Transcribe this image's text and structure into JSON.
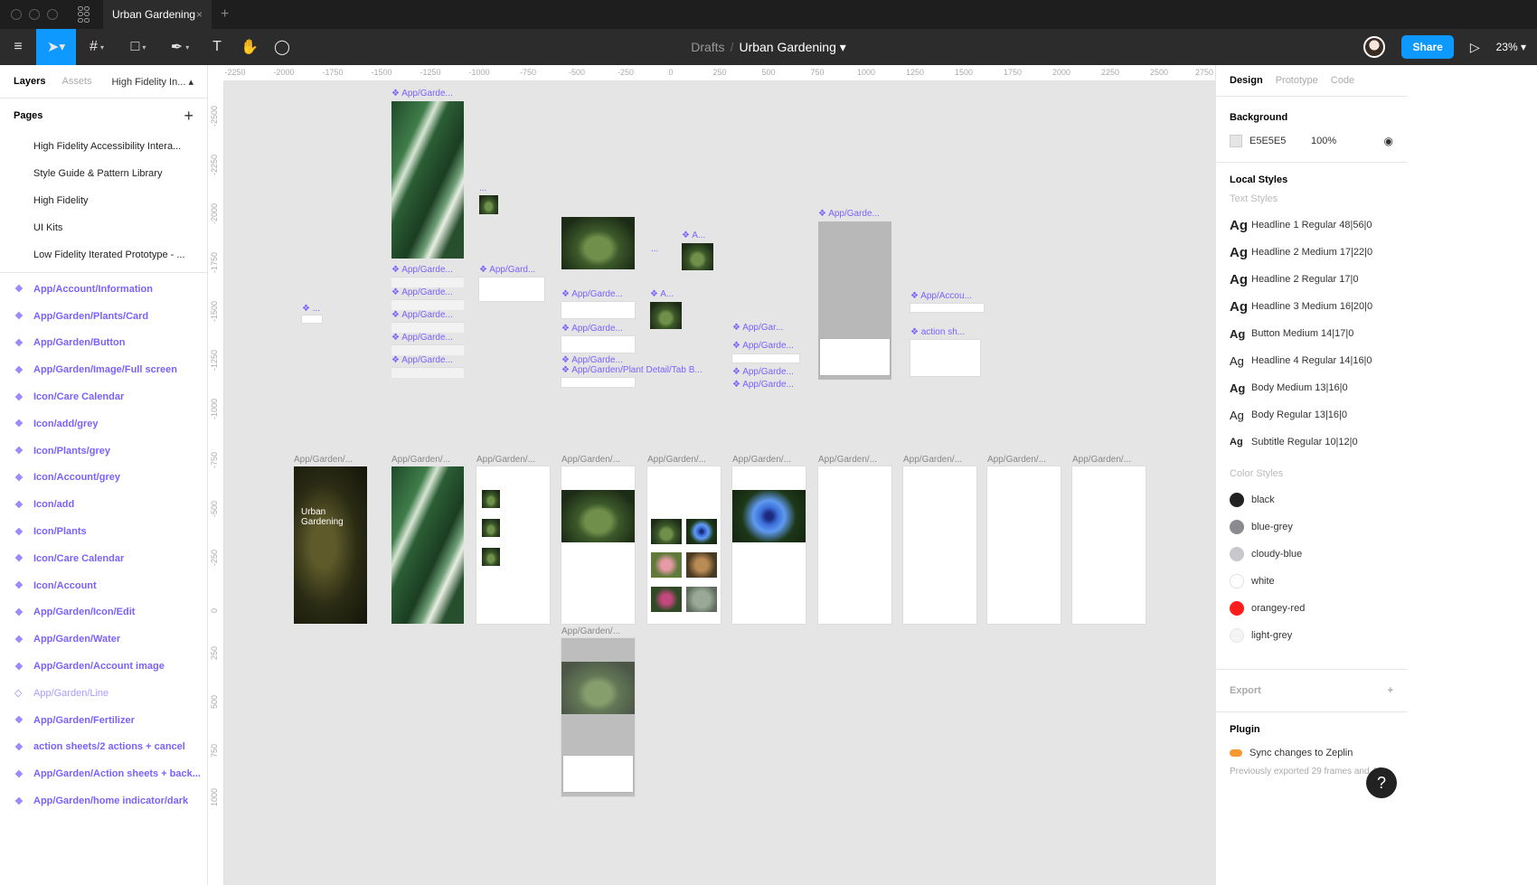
{
  "titlebar": {
    "tab_title": "Urban Gardening",
    "close": "×",
    "new_tab": "+"
  },
  "toolbar": {
    "menu_icon": "≡",
    "move_icon": "➤",
    "frame_icon": "#",
    "shape_icon": "□",
    "pen_icon": "✒",
    "text_icon": "T",
    "hand_icon": "✋",
    "comment_icon": "◯",
    "caret": "▾",
    "breadcrumb": {
      "folder": "Drafts",
      "sep": "/",
      "file": "Urban Gardening",
      "caret": "▾"
    },
    "share_label": "Share",
    "play_icon": "▷",
    "zoom": "23%",
    "zoom_caret": "▾"
  },
  "left_panel": {
    "tabs": {
      "layers": "Layers",
      "assets": "Assets",
      "page_selector": "High Fidelity In...",
      "page_caret": "▴"
    },
    "pages_title": "Pages",
    "add_page": "+",
    "pages": [
      "High Fidelity Accessibility Intera...",
      "Style Guide & Pattern Library",
      "High Fidelity",
      "UI Kits",
      "Low Fidelity Iterated Prototype - ..."
    ],
    "component_glyph": "❖",
    "component_glyph_outline": "◇",
    "layers": [
      "App/Account/Information",
      "App/Garden/Plants/Card",
      "App/Garden/Button",
      "App/Garden/Image/Full screen",
      "Icon/Care Calendar",
      "Icon/add/grey",
      "Icon/Plants/grey",
      "Icon/Account/grey",
      "Icon/add",
      "Icon/Plants",
      "Icon/Care Calendar",
      "Icon/Account",
      "App/Garden/Icon/Edit",
      "App/Garden/Water",
      "App/Garden/Account image",
      "App/Garden/Line",
      "App/Garden/Fertilizer",
      "action sheets/2 actions + cancel",
      "App/Garden/Action sheets + back...",
      "App/Garden/home indicator/dark"
    ]
  },
  "canvas": {
    "ruler_top": [
      "-2250",
      "-2000",
      "-1750",
      "-1500",
      "-1250",
      "-1000",
      "-750",
      "-500",
      "-250",
      "0",
      "250",
      "500",
      "750",
      "1000",
      "1250",
      "1500",
      "1750",
      "2000",
      "2250",
      "2500",
      "2750"
    ],
    "ruler_left": [
      "-2500",
      "-2250",
      "-2000",
      "-1750",
      "-1500",
      "-1250",
      "-1000",
      "-750",
      "-500",
      "-250",
      "0",
      "250",
      "500",
      "750",
      "1000"
    ],
    "labels": {
      "garden_top": "❖ App/Garde...",
      "garden_a": "❖ App/Garde...",
      "gard_b": "❖ App/Gard...",
      "garden_c": "❖ App/Garde...",
      "garden_d": "❖ App/Garde...",
      "garden_e": "❖ App/Garde...",
      "garden_f": "❖ App/Garde...",
      "garden_g": "❖ App/Garde...",
      "garden_h": "❖ App/Garde...",
      "garden_i": "❖ App/Garde...",
      "tab_bar": "❖ App/Garden/Plant Detail/Tab B...",
      "a_short": "❖ A...",
      "a_short2": "❖ A...",
      "gar": "❖ App/Gar...",
      "garden_j": "❖ App/Garde...",
      "garden_k": "❖ App/Garde...",
      "garden_l": "❖ App/Garde...",
      "garden_grey": "❖ App/Garde...",
      "accou": "❖ App/Accou...",
      "action_sh": "❖ action sh...",
      "dots1": "❖ ...",
      "dots2": "...",
      "dots3": "..."
    },
    "row_labels": [
      "App/Garden/...",
      "App/Garden/...",
      "App/Garden/...",
      "App/Garden/...",
      "App/Garden/...",
      "App/Garden/...",
      "App/Garden/...",
      "App/Garden/...",
      "App/Garden/...",
      "App/Garden/..."
    ],
    "bottom_label": "App/Garden/...",
    "splash_title": "Urban Gardening",
    "help": "?"
  },
  "right_panel": {
    "tabs": {
      "design": "Design",
      "prototype": "Prototype",
      "code": "Code"
    },
    "background_title": "Background",
    "background_hex": "E5E5E5",
    "background_opacity": "100%",
    "eye_icon": "◉",
    "local_styles_title": "Local Styles",
    "text_styles_title": "Text Styles",
    "ag": "Ag",
    "text_styles": [
      "Headline 1 Regular 48|56|0",
      "Headline 2 Medium 17|22|0",
      "Headline 2 Regular 17|0",
      "Headline 3 Medium 16|20|0",
      "Button Medium 14|17|0",
      "Headline 4 Regular 14|16|0",
      "Body Medium 13|16|0",
      "Body Regular 13|16|0",
      "Subtitle Regular 10|12|0"
    ],
    "color_styles_title": "Color Styles",
    "color_styles": [
      {
        "name": "black",
        "color": "#222222"
      },
      {
        "name": "blue-grey",
        "color": "#8a8a8f"
      },
      {
        "name": "cloudy-blue",
        "color": "#c7c7cc"
      },
      {
        "name": "white",
        "color": "#ffffff"
      },
      {
        "name": "orangey-red",
        "color": "#ff1e1e"
      },
      {
        "name": "light-grey",
        "color": "#f4f4f4"
      }
    ],
    "export_title": "Export",
    "export_add": "+",
    "plugin_title": "Plugin",
    "plugin_name": "Sync changes to Zeplin",
    "plugin_note": "Previously exported 29 frames and 49"
  }
}
